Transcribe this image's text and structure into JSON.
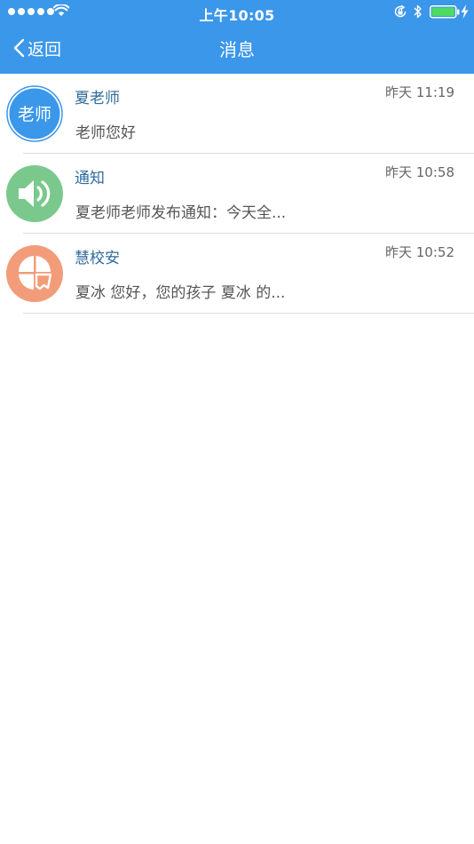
{
  "status_bar": {
    "time": "上午10:05"
  },
  "nav": {
    "back_label": "返回",
    "title": "消息"
  },
  "colors": {
    "nav_background": "#3a97e9",
    "teacher_avatar": "#3a97e9",
    "notice_avatar": "#7bc88d",
    "school_avatar": "#f29c79",
    "battery": "#4cd964"
  },
  "messages": [
    {
      "avatar_text": "老师",
      "avatar_icon": "teacher-badge",
      "name": "夏老师",
      "time": "昨天 11:19",
      "preview": "老师您好"
    },
    {
      "avatar_icon": "speaker-icon",
      "name": "通知",
      "time": "昨天 10:58",
      "preview": "夏老师老师发布通知：今天全..."
    },
    {
      "avatar_icon": "school-logo-icon",
      "name": "慧校安",
      "time": "昨天 10:52",
      "preview": "夏冰 您好，您的孩子 夏冰 的..."
    }
  ]
}
